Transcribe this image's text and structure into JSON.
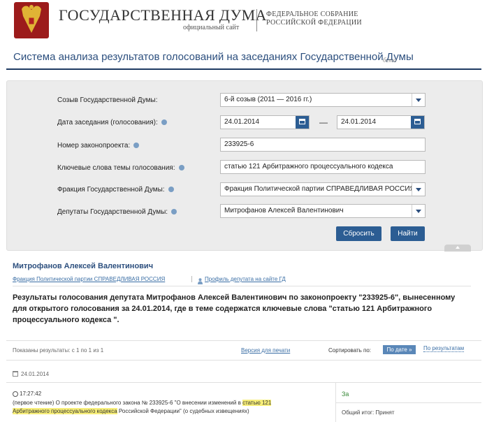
{
  "header": {
    "site_title": "ГОСУДАРСТВЕННАЯ ДУМА",
    "site_subtitle": "официальный сайт",
    "federal_line1": "ФЕДЕРАЛЬНОЕ СОБРАНИЕ",
    "federal_line2": "РОССИЙСКОЙ ФЕДЕРАЦИИ",
    "page_title": "Система анализа результатов голосований на заседаниях Государственной Думы",
    "beta_label": "бета"
  },
  "form": {
    "convocation_label": "Созыв Государственной Думы:",
    "convocation_value": "6-й созыв (2011 — 2016 гг.)",
    "date_label": "Дата заседания (голосования):",
    "date_from": "24.01.2014",
    "date_separator": "—",
    "date_to": "24.01.2014",
    "bill_label": "Номер законопроекта:",
    "bill_value": "233925-6",
    "keywords_label": "Ключевые слова темы голосования:",
    "keywords_value": "статью 121 Арбитражного процессуального кодекса",
    "faction_label": "Фракция Государственной Думы:",
    "faction_value": "Фракция Политической партии СПРАВЕДЛИВАЯ РОССИЯ",
    "deputies_label": "Депутаты Государственной Думы:",
    "deputies_value": "Митрофанов Алексей Валентинович",
    "reset_button": "Сбросить",
    "find_button": "Найти"
  },
  "results": {
    "deputy_name": "Митрофанов Алексей Валентинович",
    "faction_link": "Фракция Политической партии СПРАВЕДЛИВАЯ РОССИЯ",
    "profile_link": "Профиль депутата на сайте ГД",
    "summary": "Результаты голосования депутата Митрофанов Алексей Валентинович по законопроекту \"233925-6\", вынесенному для открытого голосования за 24.01.2014, где в теме содержатся ключевые слова \"статью 121 Арбитражного процессуального кодекса \".",
    "shown_text": "Показаны результаты: с 1 по 1 из 1",
    "print_link": "Версия для печати",
    "sort_label": "Сортировать по:",
    "sort_by_date": "По дате »",
    "sort_by_results": "По результатам",
    "date_group": "24.01.2014",
    "item": {
      "time": "17:27:42",
      "text_before": "(первое чтение) О проекте федерального закона № 233925-6 \"О внесении изменений в ",
      "text_highlight_1": "статью 121",
      "text_highlight_2": "Арбитражного процессуального кодекса",
      "text_after": " Российской Федерации\" (о судебных извещениях)",
      "vote": "За",
      "result_label": "Общий итог:",
      "result_value": "Принят"
    }
  },
  "colors": {
    "accent": "#2c5d93",
    "title_blue": "#2c4f7e",
    "highlight": "#f7ee78",
    "vote_green": "#3a8a3a"
  }
}
